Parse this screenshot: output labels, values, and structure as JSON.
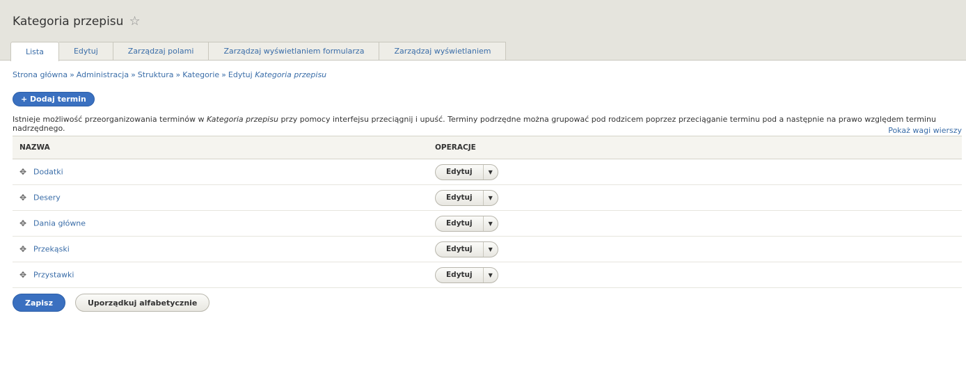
{
  "page": {
    "title": "Kategoria przepisu",
    "star_icon": "star-outline-icon"
  },
  "tabs": [
    {
      "label": "Lista",
      "active": true
    },
    {
      "label": "Edytuj",
      "active": false
    },
    {
      "label": "Zarządzaj polami",
      "active": false
    },
    {
      "label": "Zarządzaj wyświetlaniem formularza",
      "active": false
    },
    {
      "label": "Zarządzaj wyświetlaniem",
      "active": false
    }
  ],
  "breadcrumb": {
    "items": [
      "Strona główna",
      "Administracja",
      "Struktura",
      "Kategorie"
    ],
    "separator": "»",
    "last_prefix": "Edytuj",
    "last_emphasis": "Kategoria przepisu"
  },
  "add_button": "+ Dodaj termin",
  "description": {
    "before": "Istnieje możliwość przeorganizowania terminów w ",
    "emphasis": "Kategoria przepisu",
    "after": " przy pomocy interfejsu przeciągnij i upuść. Terminy podrzędne można grupować pod rodzicem poprzez przeciąganie terminu pod a następnie na prawo względem terminu nadrzędnego."
  },
  "weights_link": "Pokaż wagi wierszy",
  "table": {
    "headers": {
      "name": "NAZWA",
      "operations": "OPERACJE"
    },
    "rows": [
      {
        "name": "Dodatki",
        "action": "Edytuj"
      },
      {
        "name": "Desery",
        "action": "Edytuj"
      },
      {
        "name": "Dania główne",
        "action": "Edytuj"
      },
      {
        "name": "Przekąski",
        "action": "Edytuj"
      },
      {
        "name": "Przystawki",
        "action": "Edytuj"
      }
    ]
  },
  "buttons": {
    "save": "Zapisz",
    "sort_alpha": "Uporządkuj alfabetycznie"
  },
  "colors": {
    "primary": "#3a70c0",
    "link": "#3a6da8",
    "header_bg": "#e5e4dd"
  }
}
